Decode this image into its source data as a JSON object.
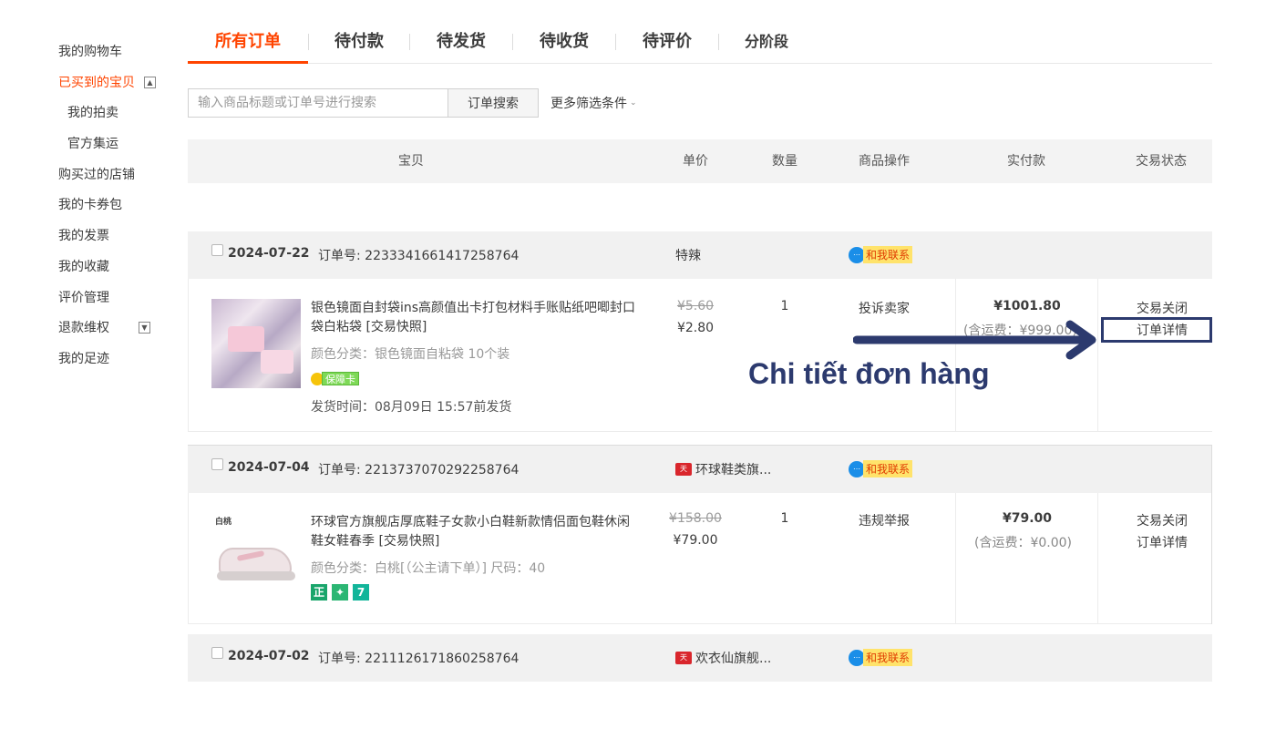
{
  "sidebar": {
    "items": [
      {
        "label": "我的购物车"
      },
      {
        "label": "已买到的宝贝",
        "toggle": "▲"
      },
      {
        "label": "我的拍卖"
      },
      {
        "label": "官方集运"
      },
      {
        "label": "购买过的店铺"
      },
      {
        "label": "我的卡券包"
      },
      {
        "label": "我的发票"
      },
      {
        "label": "我的收藏"
      },
      {
        "label": "评价管理"
      },
      {
        "label": "退款维权",
        "toggle": "▼"
      },
      {
        "label": "我的足迹"
      }
    ]
  },
  "tabs": [
    {
      "label": "所有订单"
    },
    {
      "label": "待付款"
    },
    {
      "label": "待发货"
    },
    {
      "label": "待收货"
    },
    {
      "label": "待评价"
    },
    {
      "label": "分阶段"
    }
  ],
  "search": {
    "placeholder": "输入商品标题或订单号进行搜索",
    "button": "订单搜索",
    "more_filters": "更多筛选条件",
    "chevron": "⌄"
  },
  "table_header": {
    "item": "宝贝",
    "unit_price": "单价",
    "quantity": "数量",
    "item_ops": "商品操作",
    "paid": "实付款",
    "status": "交易状态"
  },
  "orders": [
    {
      "date": "2024-07-22",
      "order_no": "订单号: 2233341661417258764",
      "shop": "特辣",
      "contact": "和我联系",
      "title": "银色镜面自封袋ins高颜值出卡打包材料手账贴纸吧唧封口袋白粘袋 [交易快照]",
      "spec": "颜色分类：银色镜面自粘袋 10个装",
      "badge": "保障卡",
      "ship_time": "发货时间：08月09日 15:57前发货",
      "price_old": "¥5.60",
      "price_new": "¥2.80",
      "qty": "1",
      "op": "投诉卖家",
      "total": "¥1001.80",
      "freight": "(含运费：¥999.00)",
      "status": "交易关闭",
      "detail": "订单详情"
    },
    {
      "date": "2024-07-04",
      "order_no": "订单号: 2213737070292258764",
      "shop": "环球鞋类旗...",
      "contact": "和我联系",
      "brand": "白桃",
      "title": "环球官方旗舰店厚底鞋子女款小白鞋新款情侣面包鞋休闲鞋女鞋春季 [交易快照]",
      "spec": "颜色分类：白桃[（公主请下单）] 尺码：40",
      "badges": [
        "正",
        "✦",
        "7"
      ],
      "price_old": "¥158.00",
      "price_new": "¥79.00",
      "qty": "1",
      "op": "违规举报",
      "total": "¥79.00",
      "freight": "(含运费：¥0.00)",
      "status": "交易关闭",
      "detail": "订单详情"
    },
    {
      "date": "2024-07-02",
      "order_no": "订单号: 2211126171860258764",
      "shop": "欢衣仙旗舰...",
      "contact": "和我联系"
    }
  ],
  "annotation": {
    "text": "Chi tiết đơn hàng",
    "color": "#2c3a6e"
  },
  "colors": {
    "accent": "#ff4400",
    "header_bg": "#f3f3f3"
  }
}
